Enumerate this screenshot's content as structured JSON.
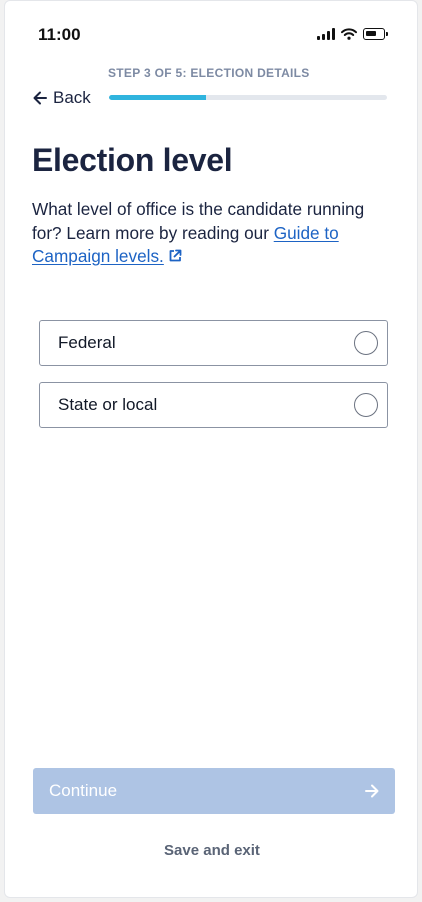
{
  "status_bar": {
    "time": "11:00",
    "icons": [
      "signal-icon",
      "wifi-icon",
      "battery-icon"
    ]
  },
  "header": {
    "step_label": "STEP 3 OF 5: ELECTION DETAILS",
    "back_label": "Back",
    "progress_fraction": 0.35
  },
  "main": {
    "title": "Election level",
    "description_text": "What level of office is the candidate running for? Learn more by reading our ",
    "guide_link_label": "Guide to Campaign levels.",
    "options": [
      {
        "label": "Federal",
        "selected": false
      },
      {
        "label": "State or local",
        "selected": false
      }
    ]
  },
  "footer": {
    "continue_label": "Continue",
    "save_exit_label": "Save and exit"
  },
  "colors": {
    "accent_progress": "#2fb4de",
    "link": "#1d63c4",
    "continue_disabled_bg": "#aec4e4",
    "heading": "#1b2440"
  }
}
